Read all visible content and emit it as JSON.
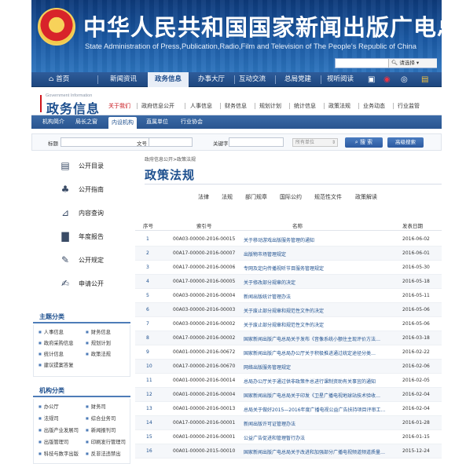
{
  "header": {
    "title_cn": "中华人民共和国国家新闻出版广电总局",
    "title_en": "State Administration of Press,Publication,Radio,Film and Television of The People's Republic of China",
    "search_select": "请选择"
  },
  "main_nav": {
    "items": [
      {
        "label": "首页"
      },
      {
        "label": "新闻资讯"
      },
      {
        "label": "政务信息"
      },
      {
        "label": "办事大厅"
      },
      {
        "label": "互动交流"
      },
      {
        "label": "总局党建"
      },
      {
        "label": "视听阅读"
      }
    ],
    "active_color": "#1f4d8c"
  },
  "sub_header": {
    "gov_en": "Government Information",
    "gov_cn": "政务信息",
    "links": [
      "关于我们",
      "政府信息公开",
      "人事信息",
      "财务信息",
      "规划计划",
      "统计信息",
      "政策法规",
      "业务动态",
      "行业监管"
    ]
  },
  "sec_nav": {
    "items": [
      "机构简介",
      "局长之窗",
      "内设机构",
      "直属单位",
      "行业协会"
    ]
  },
  "filter": {
    "title_label": "标题",
    "doc_label": "文号",
    "keyword_label": "关键字",
    "unit_select": "所有单位",
    "search_btn": "搜 索",
    "adv_btn": "高级搜索"
  },
  "sidebar": {
    "items": [
      {
        "label": "公开目录",
        "icon": "catalog-icon"
      },
      {
        "label": "公开指南",
        "icon": "guide-icon"
      },
      {
        "label": "内容查询",
        "icon": "query-icon"
      },
      {
        "label": "年度报告",
        "icon": "report-icon"
      },
      {
        "label": "公开规定",
        "icon": "rules-icon"
      },
      {
        "label": "申请公开",
        "icon": "apply-icon"
      }
    ],
    "topic_title": "主题分类",
    "topics": [
      "人事信息",
      "财务信息",
      "政府采购信息",
      "规划计划",
      "统计信息",
      "政策法规",
      "建议提案答复"
    ],
    "org_title": "机构分类",
    "orgs": [
      "办公厅",
      "财务司",
      "法规司",
      "综合业务司",
      "出版产业发展司",
      "新闻报刊司",
      "出版管理司",
      "印刷发行管理司",
      "科技与数字出版",
      "反非法违禁出"
    ]
  },
  "content": {
    "breadcrumb": "政府信息公开>政策法规",
    "title": "政策法规",
    "categories": [
      "法律",
      "法规",
      "部门规章",
      "国际公约",
      "规范性文件",
      "政策解读"
    ],
    "columns": {
      "no": "序号",
      "index": "索引号",
      "name": "名称",
      "date": "发表日期"
    },
    "rows": [
      {
        "no": "1",
        "index": "00A03-00000-2016-00015",
        "name": "关于移动游戏出版服务管理的通知",
        "date": "2016-06-02"
      },
      {
        "no": "2",
        "index": "00A17-00000-2016-00007",
        "name": "出版物市场管理规定",
        "date": "2016-06-01"
      },
      {
        "no": "3",
        "index": "00A17-00000-2016-00006",
        "name": "专网及定向传播视听节目服务管理规定",
        "date": "2016-05-30"
      },
      {
        "no": "4",
        "index": "00A17-00000-2016-00005",
        "name": "关于修改部分规章的决定",
        "date": "2016-05-18"
      },
      {
        "no": "5",
        "index": "00A03-00000-2016-00004",
        "name": "新闻出版统计管理办法",
        "date": "2016-05-11"
      },
      {
        "no": "6",
        "index": "00A03-00000-2016-00003",
        "name": "关于废止部分规章和规范性文件的决定",
        "date": "2016-05-06"
      },
      {
        "no": "7",
        "index": "00A03-00000-2016-00002",
        "name": "关于废止部分规章和规范性文件的决定",
        "date": "2016-05-06"
      },
      {
        "no": "8",
        "index": "00A17-00000-2016-00002",
        "name": "国家新闻出版广电总局关于发布《音像系统小额住主现评价方法…",
        "date": "2016-03-18"
      },
      {
        "no": "9",
        "index": "00A01-00000-2016-00672",
        "name": "国家新闻出版广电总局办公厅关于积极推进通过统定途径分类…",
        "date": "2016-02-22"
      },
      {
        "no": "10",
        "index": "00A17-00000-2016-00670",
        "name": "网络出版服务管理规定",
        "date": "2016-02-06"
      },
      {
        "no": "11",
        "index": "00A01-00000-2016-00014",
        "name": "总局办公厅关于通过供非政策件总进行课制资助有关事宜的通知",
        "date": "2016-02-05"
      },
      {
        "no": "12",
        "index": "00A01-00000-2016-00004",
        "name": "国家新闻出版广电总局关于印发《卫星广播电视地球站技术验收…",
        "date": "2016-02-04"
      },
      {
        "no": "13",
        "index": "00A01-00000-2016-00013",
        "name": "总局关于做好2015—2016年度广播电视公益广告扶持项目评审工…",
        "date": "2016-02-04"
      },
      {
        "no": "14",
        "index": "00A17-00000-2016-00001",
        "name": "新闻出版许可证管理办法",
        "date": "2016-01-28"
      },
      {
        "no": "15",
        "index": "00A01-00000-2016-00001",
        "name": "公益广告促进和管理暂行办法",
        "date": "2016-01-15"
      },
      {
        "no": "16",
        "index": "00A01-00000-2015-00010",
        "name": "国家新闻出版广电总局关于改进和加强部分广播电视频道频道质量…",
        "date": "2015-12-24"
      }
    ]
  }
}
